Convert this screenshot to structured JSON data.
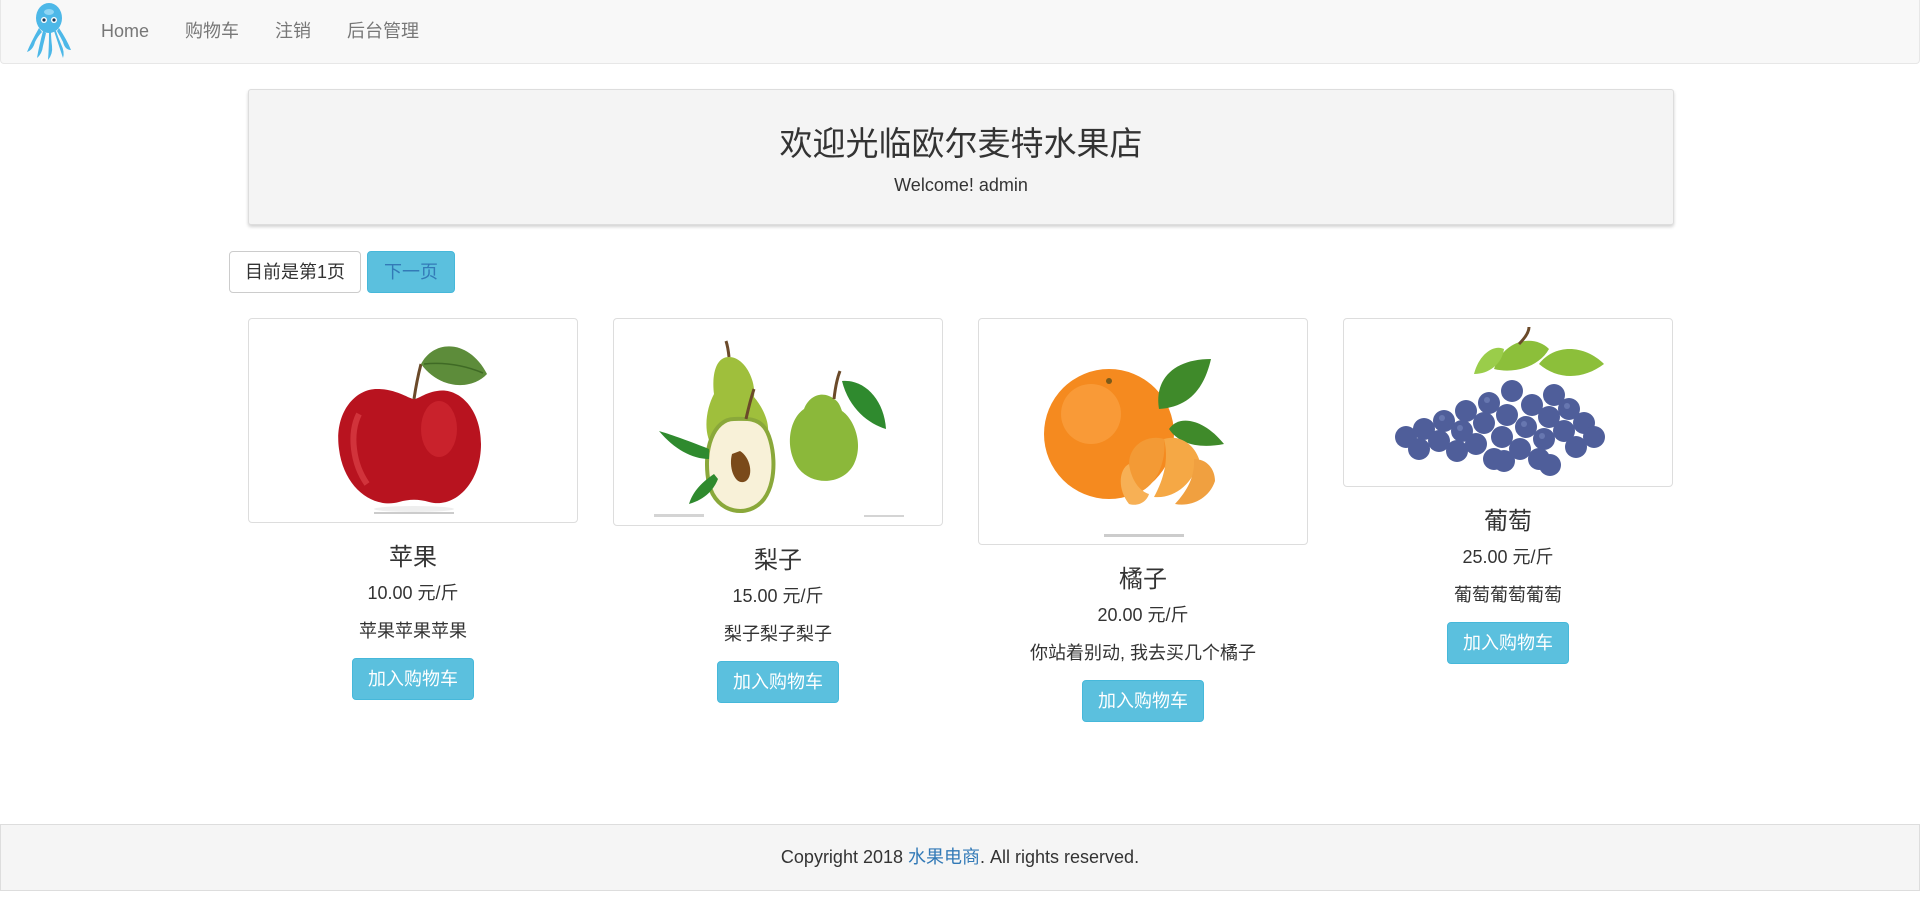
{
  "nav": {
    "items": [
      {
        "label": "Home"
      },
      {
        "label": "购物车"
      },
      {
        "label": "注销"
      },
      {
        "label": "后台管理"
      }
    ]
  },
  "jumbotron": {
    "title": "欢迎光临欧尔麦特水果店",
    "welcome": "Welcome! admin"
  },
  "pagination": {
    "current": "目前是第1页",
    "next": "下一页"
  },
  "products": [
    {
      "name": "苹果",
      "price": "10.00 元/斤",
      "description": "苹果苹果苹果",
      "button": "加入购物车",
      "image_icon": "apple-image"
    },
    {
      "name": "梨子",
      "price": "15.00 元/斤",
      "description": "梨子梨子梨子",
      "button": "加入购物车",
      "image_icon": "pear-image"
    },
    {
      "name": "橘子",
      "price": "20.00 元/斤",
      "description": "你站着别动, 我去买几个橘子",
      "button": "加入购物车",
      "image_icon": "orange-image"
    },
    {
      "name": "葡萄",
      "price": "25.00 元/斤",
      "description": "葡萄葡萄葡萄",
      "button": "加入购物车",
      "image_icon": "grape-image"
    }
  ],
  "footer": {
    "prefix": "Copyright 2018 ",
    "link": "水果电商",
    "suffix": ". All rights reserved."
  },
  "colors": {
    "accent": "#5bc0de",
    "link": "#337ab7",
    "navbar_bg": "#f8f8f8"
  }
}
